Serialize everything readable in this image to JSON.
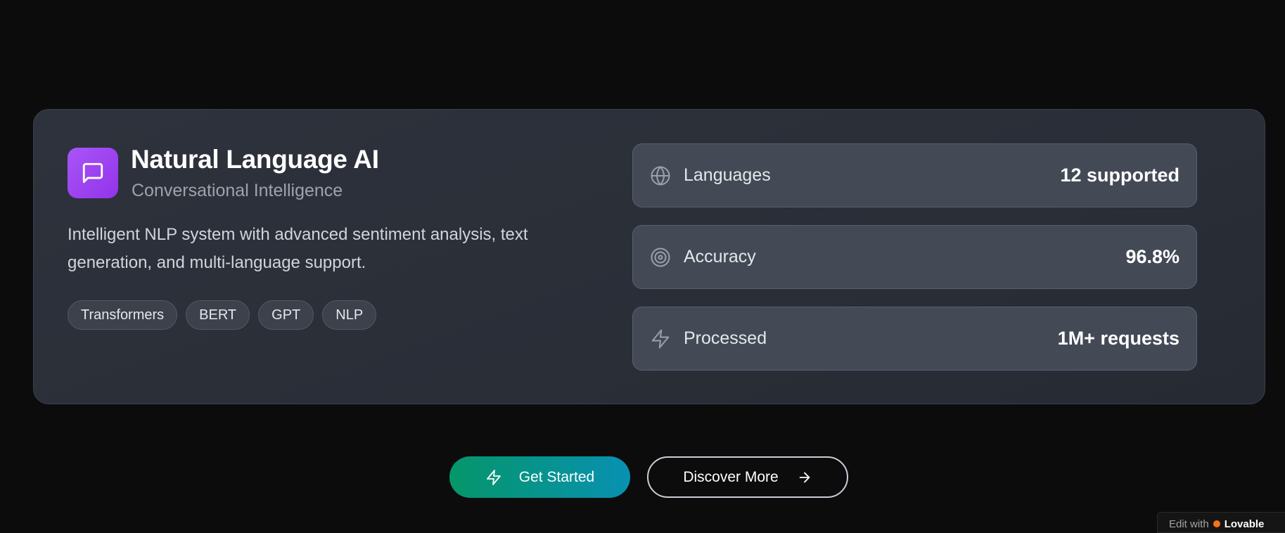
{
  "card": {
    "title": "Natural Language AI",
    "subtitle": "Conversational Intelligence",
    "description": "Intelligent NLP system with advanced sentiment analysis, text generation, and multi-language support.",
    "icon": "chat-bubble-icon",
    "icon_color": "#9333ea",
    "tags": [
      "Transformers",
      "BERT",
      "GPT",
      "NLP"
    ]
  },
  "metrics": [
    {
      "icon": "globe-icon",
      "label": "Languages",
      "value": "12 supported"
    },
    {
      "icon": "target-icon",
      "label": "Accuracy",
      "value": "96.8%"
    },
    {
      "icon": "zap-icon",
      "label": "Processed",
      "value": "1M+ requests"
    }
  ],
  "actions": {
    "primary_label": "Get Started",
    "primary_icon": "zap-icon",
    "secondary_label": "Discover More",
    "secondary_icon": "arrow-right-icon"
  },
  "badge": {
    "prefix": "Edit with",
    "brand": "Lovable"
  },
  "colors": {
    "accent_gradient_start": "#059669",
    "accent_gradient_end": "#0891b2",
    "background": "#0c0c0d"
  }
}
